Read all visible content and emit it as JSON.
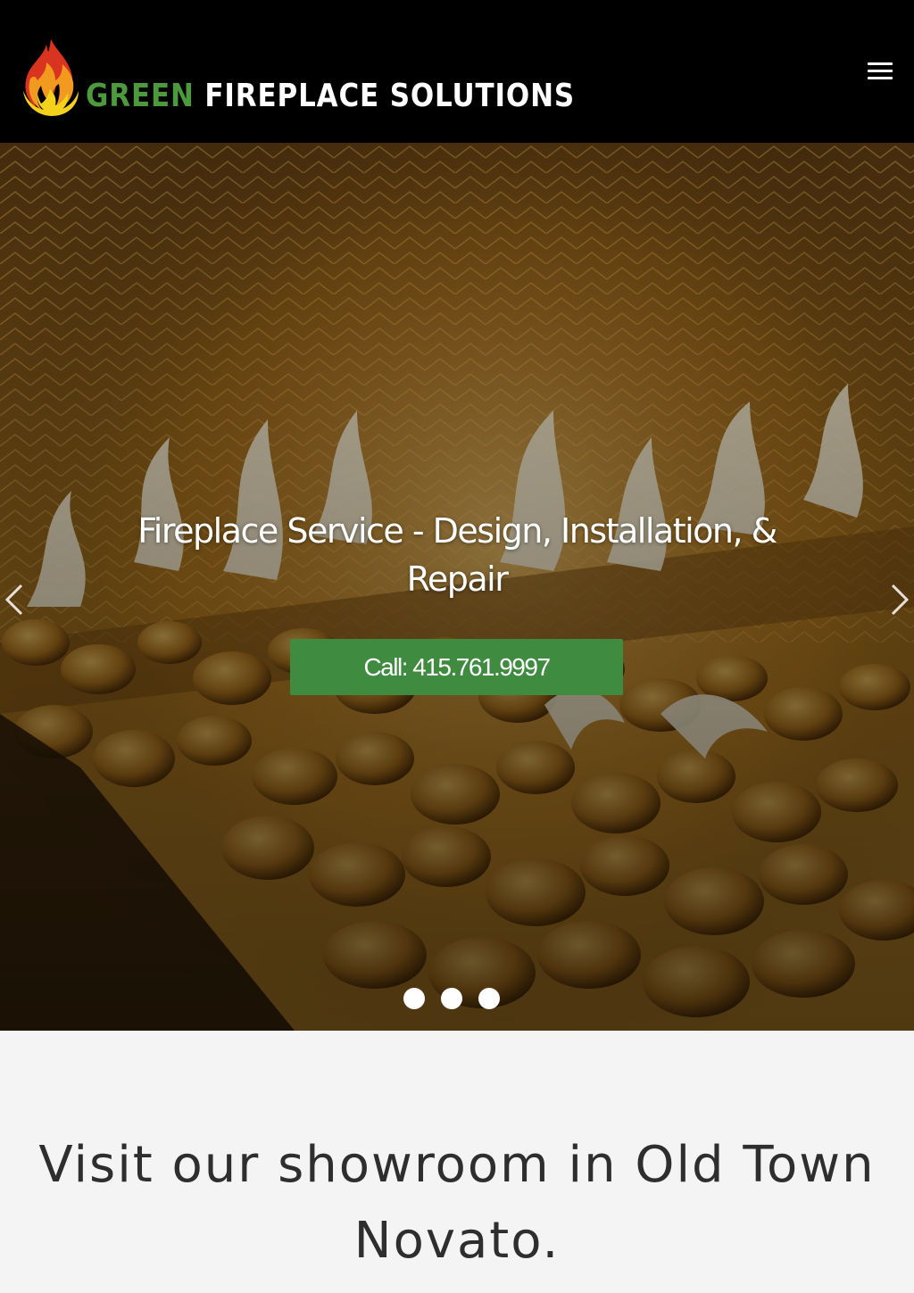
{
  "header": {
    "logo_word_green": "GREEN",
    "logo_word_white": "FIREPLACE SOLUTIONS",
    "menu_icon": "hamburger-menu-icon"
  },
  "hero": {
    "title": "Fireplace Service -  Design, Installation, & Repair",
    "cta_label": "Call: 415.761.9997",
    "prev_icon": "chevron-left-icon",
    "next_icon": "chevron-right-icon",
    "slide_count": 3
  },
  "showroom": {
    "heading": "Visit our showroom in Old Town Novato."
  },
  "colors": {
    "header_bg": "#000000",
    "brand_green": "#4c9a3d",
    "cta_green": "#3f8b40",
    "section_bg": "#f4f4f4",
    "heading_text": "#2e2e2e"
  }
}
